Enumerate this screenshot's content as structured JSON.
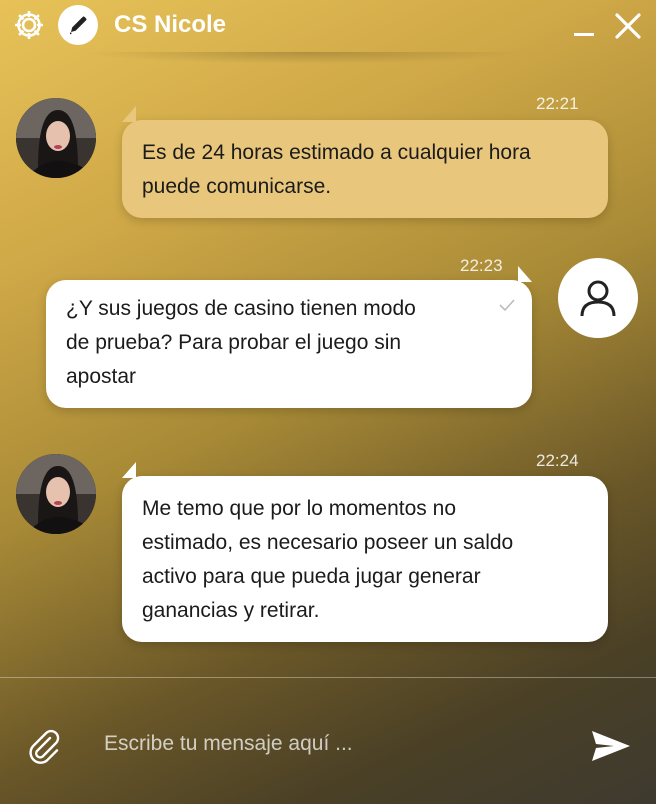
{
  "header": {
    "title": "CS Nicole",
    "icons": [
      "gear-icon",
      "pencil-icon",
      "minimize-icon",
      "close-icon"
    ]
  },
  "messages": [
    {
      "sender": "agent",
      "time": "22:21",
      "text": "Es de 24 horas estimado a cualquier hora\npuede comunicarse."
    },
    {
      "sender": "user",
      "time": "22:23",
      "text": "¿Y sus juegos de casino tienen modo\nde prueba? Para probar el juego sin\napostar"
    },
    {
      "sender": "agent",
      "time": "22:24",
      "text": "Me temo que por lo momentos no\nestimado, es necesario poseer un saldo\nactivo para que pueda jugar generar\nganancias y retirar."
    }
  ],
  "composer": {
    "placeholder": "Escribe tu mensaje aquí ...",
    "value": ""
  },
  "colors": {
    "agent_bubble_first": "#e8c77c",
    "bubble_white": "#ffffff",
    "header_text": "#ffffff"
  }
}
